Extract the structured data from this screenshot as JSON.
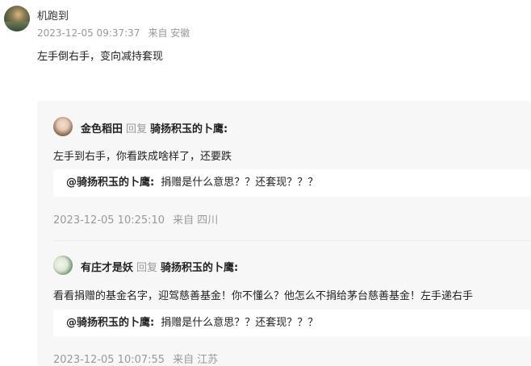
{
  "post": {
    "username": "机跑到",
    "timestamp": "2023-12-05 09:37:37",
    "from": "来自 安徽",
    "text": "左手倒右手，变向减持套现"
  },
  "replies": [
    {
      "avatar_icon": "portrait-avatar",
      "author": "金色稻田",
      "reply_keyword": "回复",
      "target": "骑扬积玉的卜鹰:",
      "text": "左手到右手，你看跌成啥样了，还要跌",
      "quote": {
        "name": "@骑扬积玉的卜鹰:",
        "text": "捐赠是什么意思？？还套现？？？"
      },
      "timestamp": "2023-12-05 10:25:10",
      "from": "来自 四川"
    },
    {
      "avatar_icon": "plant-avatar",
      "author": "有庄才是妖",
      "reply_keyword": "回复",
      "target": "骑扬积玉的卜鹰:",
      "text": "看看捐赠的基金名字，迎驾慈善基金！你不懂么？他怎么不捐给茅台慈善基金！左手递右手",
      "quote": {
        "name": "@骑扬积玉的卜鹰:",
        "text": "捐赠是什么意思？？还套现？？？"
      },
      "timestamp": "2023-12-05 10:07:55",
      "from": "来自 江苏"
    }
  ]
}
